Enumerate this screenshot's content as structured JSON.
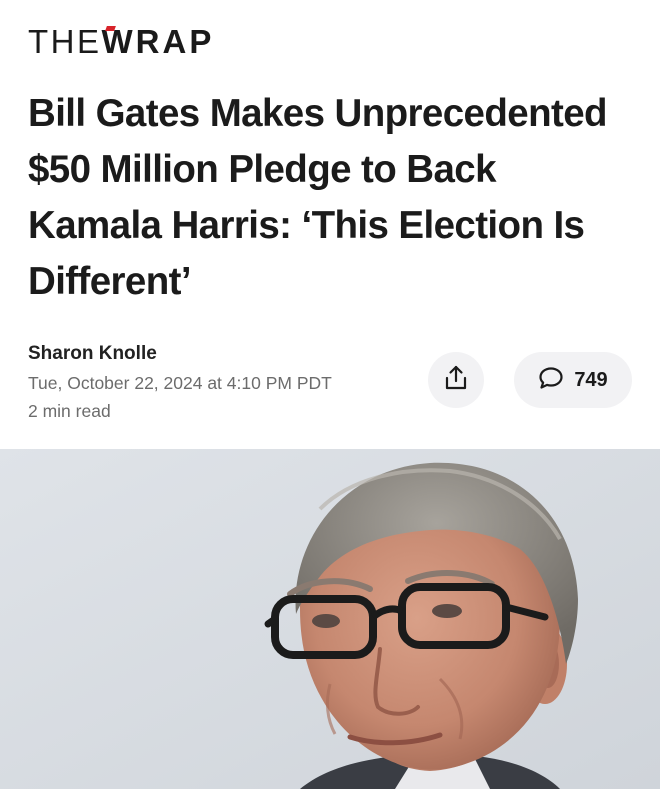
{
  "brand": {
    "the": "THE",
    "w": "W",
    "rap": "RAP"
  },
  "article": {
    "headline": "Bill Gates Makes Unprecedented $50 Million Pledge to Back Kamala Harris: ‘This Election Is Different’",
    "author": "Sharon Knolle",
    "date": "Tue, October 22, 2024 at 4:10 PM PDT",
    "read_time": "2 min read"
  },
  "actions": {
    "share_icon": "share-icon",
    "comment_icon": "speech-bubble-icon",
    "comment_count": "749"
  },
  "colors": {
    "brand_accent": "#d8232a",
    "text_primary": "#1b1b1b",
    "text_secondary": "#6c6c6c",
    "button_bg": "#f2f2f4"
  }
}
